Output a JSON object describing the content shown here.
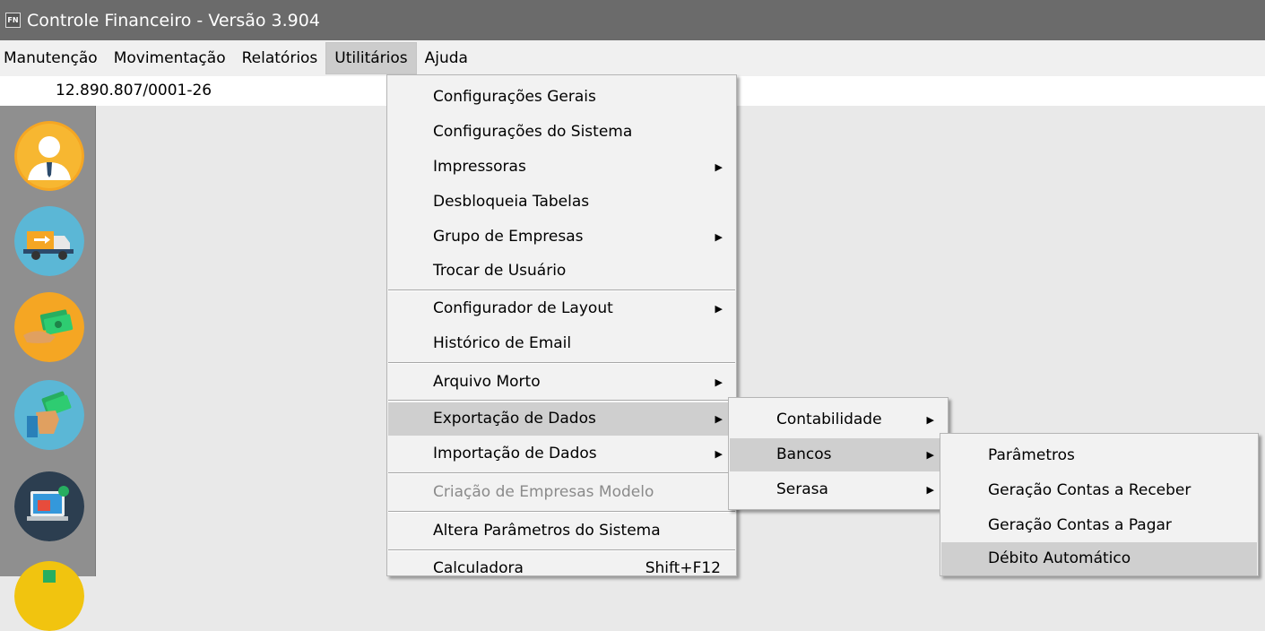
{
  "window": {
    "app_icon": "FN",
    "title": "Controle Financeiro - Versão 3.904"
  },
  "menubar": [
    "Manutenção",
    "Movimentação",
    "Relatórios",
    "Utilitários",
    "Ajuda"
  ],
  "company_id": "12.890.807/0001-26",
  "sidebar_icons": [
    "user-icon",
    "delivery-truck-icon",
    "money-hand-icon",
    "payment-hand-icon",
    "computer-screen-icon",
    "partial-icon"
  ],
  "utilitarios_menu": {
    "items": [
      {
        "label": "Configurações Gerais"
      },
      {
        "label": "Configurações do Sistema"
      },
      {
        "label": "Impressoras",
        "submenu": true
      },
      {
        "label": "Desbloqueia Tabelas"
      },
      {
        "label": "Grupo de Empresas",
        "submenu": true
      },
      {
        "label": "Trocar de Usuário"
      },
      {
        "label": "Configurador de Layout",
        "submenu": true
      },
      {
        "label": "Histórico de Email"
      },
      {
        "label": "Arquivo Morto",
        "submenu": true
      },
      {
        "label": "Exportação de Dados",
        "submenu": true,
        "highlighted": true
      },
      {
        "label": "Importação de Dados",
        "submenu": true
      },
      {
        "label": "Criação de Empresas Modelo",
        "disabled": true
      },
      {
        "label": "Altera Parâmetros do Sistema"
      },
      {
        "label": "Calculadora",
        "shortcut": "Shift+F12"
      }
    ]
  },
  "exportacao_submenu": {
    "items": [
      {
        "label": "Contabilidade",
        "submenu": true
      },
      {
        "label": "Bancos",
        "submenu": true,
        "highlighted": true
      },
      {
        "label": "Serasa",
        "submenu": true
      }
    ]
  },
  "bancos_submenu": {
    "items": [
      {
        "label": "Parâmetros"
      },
      {
        "label": "Geração Contas a Receber"
      },
      {
        "label": "Geração Contas a Pagar"
      },
      {
        "label": "Débito Automático",
        "highlighted": true
      }
    ]
  },
  "colors": {
    "titlebar": "#6b6b6b",
    "sidebar": "#8f8f8f",
    "menu_bg": "#f2f2f2",
    "highlight": "#cfcfcf"
  }
}
